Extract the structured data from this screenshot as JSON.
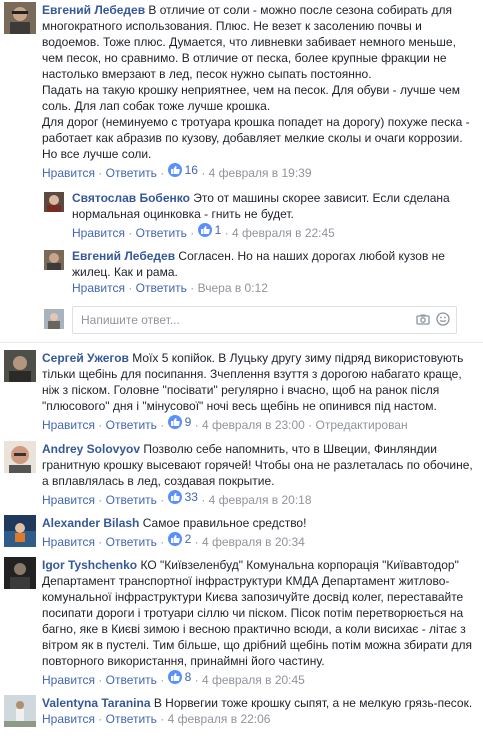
{
  "labels": {
    "like": "Нравится",
    "reply": "Ответить",
    "dot": "·",
    "edited": "Отредактирован"
  },
  "reply_placeholder": "Напишите ответ...",
  "colors": {
    "link": "#365899",
    "action": "#4267b2",
    "meta": "#90949c",
    "like_badge": "#5890ff"
  },
  "comments": [
    {
      "author": "Евгений Лебедев",
      "text": "В отличие от соли - можно после сезона собирать для многократного использования. Плюс. Не везет к засолению почвы и водоемов. Тоже плюс. Думается, что ливневки забивает немного меньше, чем песок, но сравнимо. В отличие от песка, более крупные фракции не настолько вмерзают в лед, песок нужно сыпать постоянно.\nПадать на такую крошку неприятнее, чем на песок. Для обуви - лучше чем соль. Для лап собак тоже лучше крошка.\nДля дорог (неминуемо с тротуара крошка попадет на дорогу) похуже песка - работает как абразив по кузову, добавляет мелкие сколы и очаги коррозии. Но все лучше соли.",
      "likes": "16",
      "date": "4 февраля в 19:39"
    },
    {
      "author": "Святослав Бобенко",
      "text": "Это от машины скорее зависит. Если сделана нормальная оцинковка - гнить не будет.",
      "likes": "1",
      "date": "4 февраля в 22:45"
    },
    {
      "author": "Евгений Лебедев",
      "text": "Согласен. Но на наших дорогах любой кузов не жилец. Как и рама.",
      "date": "Вчера в 0:12"
    },
    {
      "author": "Сергей Ужегов",
      "text": "Моїх 5 копійок. В Луцьку другу зиму підряд використовують тільки щебінь для посипання. Зчеплення взуття з дорогою набагато краще, ніж з піском. Головне \"посівати\" регулярно і вчасно, щоб на ранок після \"плюсового\" дня і \"мінусової\" ночі весь щебінь не опинився під настом.",
      "likes": "9",
      "date": "4 февраля в 23:00"
    },
    {
      "author": "Andrey Solovyov",
      "text": "Позволю себе напомнить, что в Швеции, Финляндии гранитную крошку высевают горячей! Чтобы она не разлеталась по обочине, а вплавлялась в лед, создавая покрытие.",
      "likes": "33",
      "date": "4 февраля в 20:18"
    },
    {
      "author": "Alexander Bilash",
      "text": "Самое правильное средство!",
      "likes": "2",
      "date": "4 февраля в 20:34"
    },
    {
      "author": "Igor Tyshchenko",
      "text": "КО \"Київзеленбуд\" Комунальна корпорація \"Київавтодор\" Департамент транспортної інфраструктури КМДА Департамент житлово-комунальної інфраструктури Києва запозичуйте досвід колег, переставайте посипати дороги і тротуари сіллю чи піском. Пісок потім перетворюється на багно, яке в Києві зимою і весною практично всюди, а коли висихає - літає з вітром як в пустелі. Тим більше, що дрібний щебінь потім можна збирати для повторного використання, принаймні його частину.",
      "likes": "8",
      "date": "4 февраля в 20:45"
    },
    {
      "author": "Valentyna Taranina",
      "text": "В Норвегии тоже крошку сыпят, а не мелкую грязь-песок.",
      "date": "4 февраля в 22:06"
    }
  ]
}
